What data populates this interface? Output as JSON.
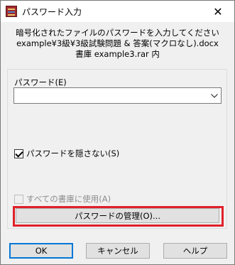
{
  "window": {
    "title": "パスワード入力",
    "close_glyph": "✕"
  },
  "info": {
    "line1": "暗号化されたファイルのパスワードを入力してください",
    "line2": "example¥3級¥3級試験問題 & 答案(マクロなし).docx",
    "line3": "書庫 example3.rar 内"
  },
  "password": {
    "label": "パスワード(E)",
    "value": "",
    "arrow_glyph": "⌵"
  },
  "options": {
    "show_password_label": "パスワードを隠さない(S)",
    "show_password_checked": true,
    "use_all_archives_label": "すべての書庫に使用(A)",
    "use_all_archives_checked": false,
    "use_all_archives_enabled": false
  },
  "manage_button": {
    "label": "パスワードの管理(O)...",
    "highlight_color": "#e0202a"
  },
  "buttons": {
    "ok": "OK",
    "cancel": "キャンセル",
    "help": "ヘルプ"
  }
}
